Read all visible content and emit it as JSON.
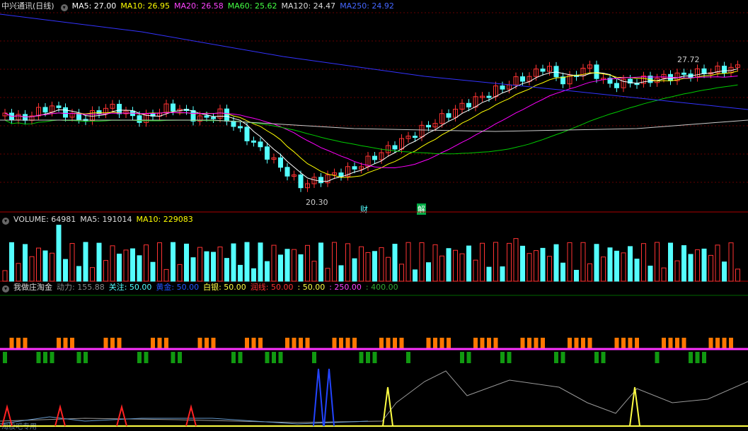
{
  "price_panel": {
    "title": "中兴通讯(日线)",
    "ma5": "MA5: 27.00",
    "ma10": "MA10: 26.95",
    "ma20": "MA20: 26.58",
    "ma60": "MA60: 25.62",
    "ma120": "MA120: 24.47",
    "ma250": "MA250: 24.92",
    "high_label": "27.72",
    "low_label": "20.30",
    "marker_cai": "财",
    "marker_jie": "解",
    "colors": {
      "ma5": "#ffffff",
      "ma10": "#ffff00",
      "ma20": "#ff00ff",
      "ma60": "#00ff00",
      "ma120": "#ffffff",
      "ma250": "#3333ff",
      "up": "#ff3333",
      "down": "#54ffff"
    }
  },
  "volume_panel": {
    "volume": "VOLUME: 64981",
    "ma5": "MA5: 191014",
    "ma10": "MA10: 229083"
  },
  "indicator_panel": {
    "name": "我做庄淘金",
    "dongli": "动力: 155.88",
    "guanzhu": "关注: 50.00",
    "huangjin": "黄金: 50.00",
    "baiyin": "白银: 50.00",
    "runxian": "润线: 50.00",
    "v1": ": 50.00",
    "v2": ": 250.00",
    "v3": ": 400.00"
  },
  "watermark": "淘股吧专用"
}
